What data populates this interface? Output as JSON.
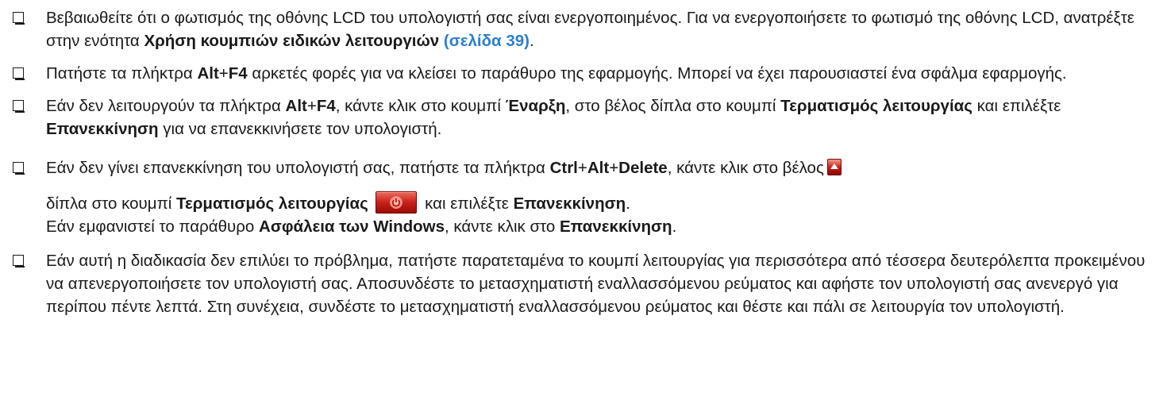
{
  "items": [
    {
      "segments": [
        "Βεβαιωθείτε ότι ο φωτισμός της οθόνης LCD του υπολογιστή σας είναι ενεργοποιημένος. Για να ενεργοποιήσετε το φωτισμό της οθόνης LCD, ανατρέξτε στην ενότητα ",
        "Χρήση κουμπιών ειδικών λειτουργιών",
        " ",
        "(σελίδα 39)",
        "."
      ]
    },
    {
      "segments": [
        "Πατήστε τα πλήκτρα ",
        "Alt",
        "+",
        "F4",
        " αρκετές φορές για να κλείσει το παράθυρο της εφαρμογής. Μπορεί να έχει παρουσιαστεί ένα σφάλμα εφαρμογής."
      ]
    },
    {
      "segments": [
        "Εάν δεν λειτουργούν τα πλήκτρα ",
        "Alt",
        "+",
        "F4",
        ", κάντε κλικ στο κουμπί ",
        "Έναρξη",
        ", στο βέλος δίπλα στο κουμπί ",
        "Τερματισμός λειτουργίας",
        " και επιλέξτε ",
        "Επανεκκίνηση",
        " για να επανεκκινήσετε τον υπολογιστή."
      ]
    },
    {
      "segments": [
        "Εάν δεν γίνει επανεκκίνηση του υπολογιστή σας, πατήστε τα πλήκτρα ",
        "Ctrl",
        "+",
        "Alt",
        "+",
        "Delete",
        ", κάντε κλικ στο βέλος",
        "δίπλα στο κουμπί ",
        "Τερματισμός λειτουργίας",
        " και επιλέξτε ",
        "Επανεκκίνηση",
        ".",
        "Εάν εμφανιστεί το παράθυρο ",
        "Ασφάλεια των Windows",
        ", κάντε κλικ στο ",
        "Επανεκκίνηση",
        "."
      ]
    },
    {
      "segments": [
        "Εάν αυτή η διαδικασία δεν επιλύει το πρόβλημα, πατήστε παρατεταμένα το κουμπί λειτουργίας για περισσότερα από τέσσερα δευτερόλεπτα προκειμένου να απενεργοποιήσετε τον υπολογιστή σας. Αποσυνδέστε το μετασχηματιστή εναλλασσόμενου ρεύματος και αφήστε τον υπολογιστή σας ανενεργό για περίπου πέντε λεπτά. Στη συνέχεια, συνδέστε το μετασχηματιστή εναλλασσόμενου ρεύματος και θέστε και πάλι σε λειτουργία τον υπολογιστή."
      ]
    }
  ],
  "icons": {
    "checkbox": "checkbox-icon",
    "arrow_button": "arrow-up-button-icon",
    "power_button": "power-button-icon"
  },
  "colors": {
    "link": "#2a7fd0",
    "text": "#1a1a1a",
    "button_red": "#c41a10"
  }
}
